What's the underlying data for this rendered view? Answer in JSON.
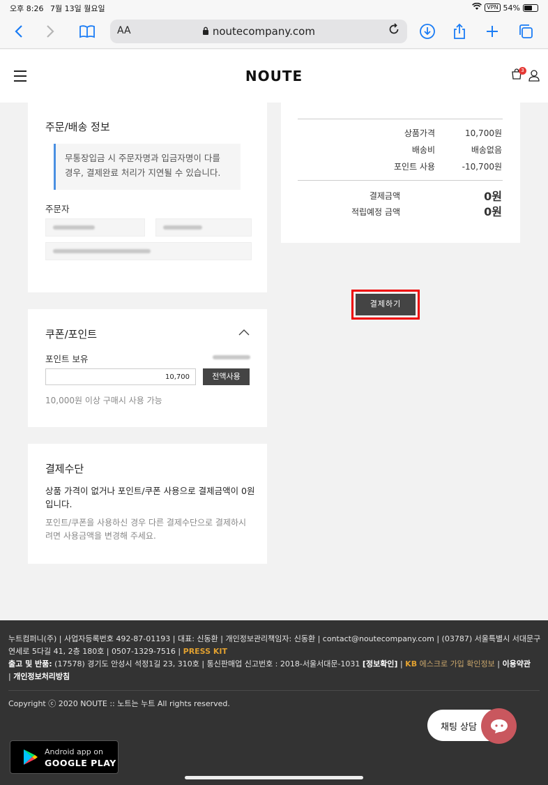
{
  "status_bar": {
    "time": "오후 8:26",
    "date": "7월 13일 월요일",
    "vpn": "VPN",
    "battery": "54%"
  },
  "browser": {
    "aa_label": "AA",
    "url": "noutecompany.com"
  },
  "site": {
    "logo": "NOUTE",
    "cart_count": "3"
  },
  "order_info": {
    "title": "주문/배송 정보",
    "notice_line1": "무통장입금 시 주문자명과 입금자명이 다를",
    "notice_line2": "경우, 결제완료 처리가 지연될 수 있습니다.",
    "orderer_label": "주문자"
  },
  "coupon_point": {
    "title": "쿠폰/포인트",
    "point_label": "포인트 보유",
    "point_value": "10,700",
    "use_all_label": "전액사용",
    "hint": "10,000원 이상 구매시 사용 가능"
  },
  "payment_method": {
    "title": "결제수단",
    "message_line1": "상품 가격이 없거나 포인트/쿠폰 사용으로 결제금액이 0원",
    "message_line2": "입니다.",
    "sub_line1": "포인트/쿠폰을 사용하신 경우 다른 결제수단으로 결제하시",
    "sub_line2": "려면 사용금액을 변경해 주세요."
  },
  "summary": {
    "rows": [
      {
        "label": "상품가격",
        "value": "10,700원"
      },
      {
        "label": "배송비",
        "value": "배송없음"
      },
      {
        "label": "포인트 사용",
        "value": "-10,700원"
      }
    ],
    "total_label": "결제금액",
    "total_value": "0원",
    "reward_label": "적립예정 금액",
    "reward_value": "0원",
    "pay_button": "결제하기"
  },
  "footer": {
    "company_line": "누트컴퍼니(주) | 사업자등록번호 492-87-01193 | 대표: 신동환 | 개인정보관리책임자: 신동환 | contact@noutecompany.com | (03787) 서울특별시 서대문구",
    "address_line_a": "연세로 5다길 41, 2층 180호 | 0507-1329-7516 | ",
    "press_kit": "PRESS KIT",
    "return_label": "출고 및 반품:",
    "return_text": " (17578) 경기도 안성시 석정1길 23, 310호 | 통신판매업 신고번호 : 2018-서울서대문-1031 ",
    "info_check": "[정보확인]",
    "sep": " | ",
    "kb": "KB",
    "escrow": " 에스크로 가입 확인정보",
    "terms": "이용약관",
    "privacy_prefix": "| ",
    "privacy": "개인정보처리방침",
    "copyright": "Copyright ⓒ 2020 NOUTE :: 노트는 누트 All rights reserved.",
    "gplay_small": "Android app on",
    "gplay_big": "GOOGLE PLAY",
    "chat_label": "채팅 상담"
  }
}
